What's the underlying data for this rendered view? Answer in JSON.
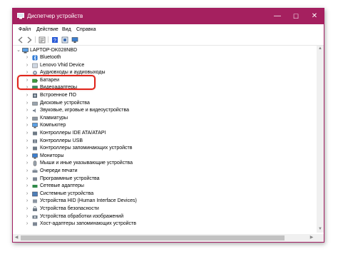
{
  "window": {
    "title": "Диспетчер устройств",
    "controls": {
      "minimize": "—",
      "maximize": "☐",
      "close": "✕"
    }
  },
  "menu": [
    "Файл",
    "Действие",
    "Вид",
    "Справка"
  ],
  "toolbar": [
    "back-icon",
    "forward-icon",
    "properties-icon",
    "help-icon",
    "update-driver-icon",
    "monitor-icon"
  ],
  "tree": {
    "root": "LAPTOP-DK028NBD",
    "items": [
      {
        "label": "Bluetooth",
        "icon": "bluetooth-icon"
      },
      {
        "label": "Lenovo Vhid Device",
        "icon": "device-icon"
      },
      {
        "label": "Аудиовходы и аудиовыходы",
        "icon": "audio-icon"
      },
      {
        "label": "Батареи",
        "icon": "battery-icon"
      },
      {
        "label": "Видеоадаптеры",
        "icon": "display-adapter-icon"
      },
      {
        "label": "Встроенное ПО",
        "icon": "firmware-icon"
      },
      {
        "label": "Дисковые устройства",
        "icon": "disk-icon"
      },
      {
        "label": "Звуковые, игровые и видеоустройства",
        "icon": "sound-icon"
      },
      {
        "label": "Клавиатуры",
        "icon": "keyboard-icon"
      },
      {
        "label": "Компьютер",
        "icon": "computer-icon"
      },
      {
        "label": "Контроллеры IDE ATA/ATAPI",
        "icon": "ide-controller-icon"
      },
      {
        "label": "Контроллеры USB",
        "icon": "usb-icon"
      },
      {
        "label": "Контроллеры запоминающих устройств",
        "icon": "storage-controller-icon"
      },
      {
        "label": "Мониторы",
        "icon": "monitor-icon"
      },
      {
        "label": "Мыши и иные указывающие устройства",
        "icon": "mouse-icon"
      },
      {
        "label": "Очереди печати",
        "icon": "printer-icon"
      },
      {
        "label": "Программные устройства",
        "icon": "software-device-icon"
      },
      {
        "label": "Сетевые адаптеры",
        "icon": "network-adapter-icon"
      },
      {
        "label": "Системные устройства",
        "icon": "system-device-icon"
      },
      {
        "label": "Устройства HID (Human Interface Devices)",
        "icon": "hid-icon"
      },
      {
        "label": "Устройства безопасности",
        "icon": "security-device-icon"
      },
      {
        "label": "Устройства обработки изображений",
        "icon": "camera-icon"
      },
      {
        "label": "Хост-адаптеры запоминающих устройств",
        "icon": "storage-host-icon"
      }
    ]
  },
  "colors": {
    "titlebar": "#a5205f",
    "highlight": "#e0241a"
  }
}
